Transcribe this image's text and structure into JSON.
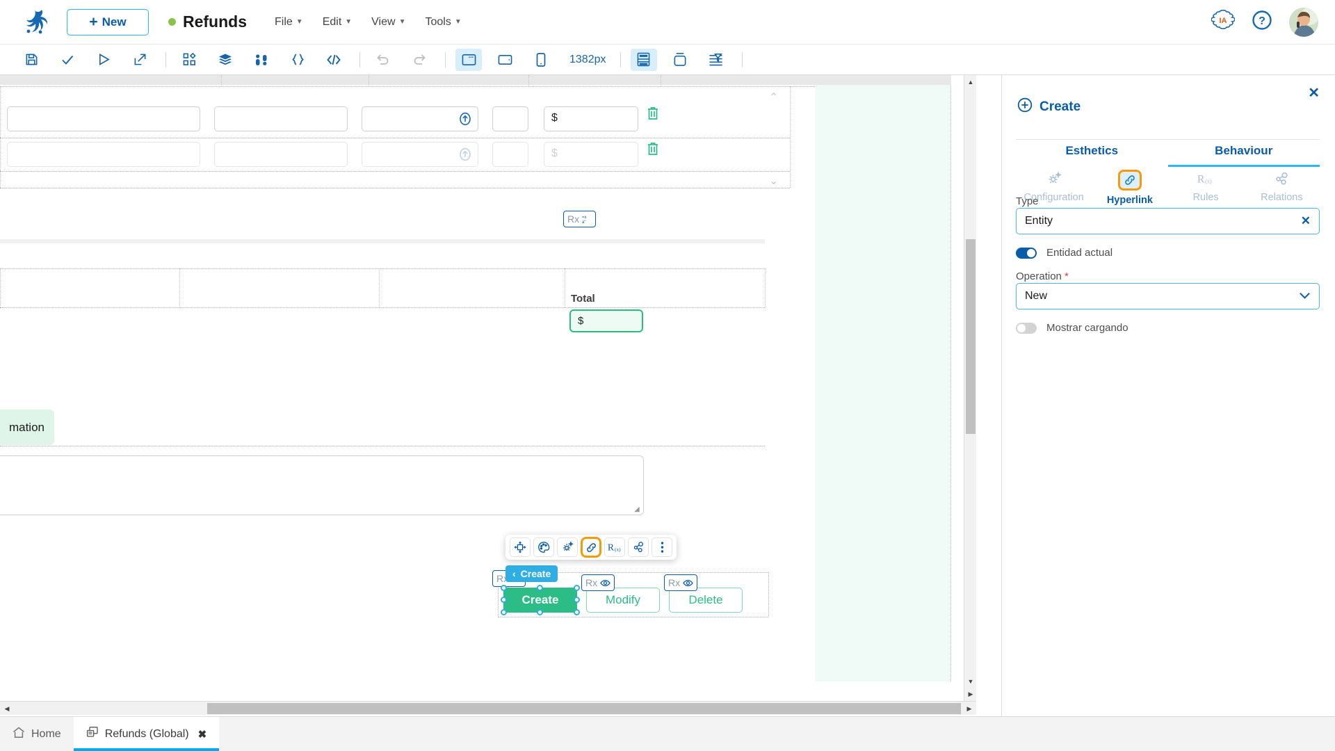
{
  "topbar": {
    "logo_icon": "frog-logo-icon",
    "new_button": {
      "label": "New",
      "plus": "+"
    },
    "document": {
      "title": "Refunds",
      "status_dot": "green"
    },
    "menus": [
      {
        "label": "File"
      },
      {
        "label": "Edit"
      },
      {
        "label": "View"
      },
      {
        "label": "Tools"
      }
    ],
    "right_icons": [
      {
        "name": "ia-icon",
        "label": "IA"
      },
      {
        "name": "help-icon",
        "label": "?"
      },
      {
        "name": "avatar",
        "label": ""
      }
    ]
  },
  "toolbar": {
    "zoom_value": "1382px",
    "buttons": [
      {
        "name": "save-icon",
        "state": "enabled"
      },
      {
        "name": "check-icon",
        "state": "enabled"
      },
      {
        "name": "run-icon",
        "state": "enabled"
      },
      {
        "name": "export-icon",
        "state": "enabled"
      },
      {
        "name": "components-icon",
        "state": "enabled"
      },
      {
        "name": "layers-icon",
        "state": "enabled"
      },
      {
        "name": "variables-icon",
        "state": "enabled"
      },
      {
        "name": "braces-icon",
        "state": "enabled"
      },
      {
        "name": "code-icon",
        "state": "enabled"
      },
      {
        "name": "undo-icon",
        "state": "disabled"
      },
      {
        "name": "redo-icon",
        "state": "disabled"
      },
      {
        "name": "desktop-view-icon",
        "state": "active"
      },
      {
        "name": "tablet-view-icon",
        "state": "enabled"
      },
      {
        "name": "mobile-view-icon",
        "state": "enabled"
      },
      {
        "name": "grid-layout-icon",
        "state": "active"
      },
      {
        "name": "container-icon",
        "state": "enabled"
      },
      {
        "name": "filter-icon",
        "state": "enabled"
      }
    ]
  },
  "canvas": {
    "grid": {
      "rows": [
        {
          "dollar": "$",
          "faded": false
        },
        {
          "dollar": "$",
          "faded": true
        }
      ],
      "delete_icon": "trash-icon",
      "stepper_icon": "upload-circle-icon",
      "scroll_up_icon": "chevron-up-icon",
      "scroll_down_icon": "chevron-down-icon"
    },
    "total": {
      "label": "Total",
      "value": "$",
      "badge": {
        "prefix": "Rx",
        "icon": "text-format-icon"
      }
    },
    "info_tag": {
      "label": "mation"
    },
    "element_toolbar": {
      "buttons": [
        {
          "name": "move-icon",
          "selected": false
        },
        {
          "name": "palette-icon",
          "selected": false
        },
        {
          "name": "settings-icon",
          "selected": false
        },
        {
          "name": "hyperlink-icon",
          "selected": true
        },
        {
          "name": "rules-icon",
          "selected": false
        },
        {
          "name": "relations-icon",
          "selected": false
        },
        {
          "name": "more-options-icon",
          "selected": false
        }
      ]
    },
    "selection_label": {
      "chevron": "‹",
      "label": "Create"
    },
    "action_buttons": [
      {
        "label": "Create",
        "style": "primary",
        "badge": {
          "prefix": "Rx",
          "icon": "eye-icon"
        }
      },
      {
        "label": "Modify",
        "style": "outline",
        "badge": {
          "prefix": "Rx",
          "icon": "eye-icon"
        }
      },
      {
        "label": "Delete",
        "style": "outline",
        "badge": {
          "prefix": "Rx",
          "icon": "eye-icon"
        }
      }
    ]
  },
  "right_panel": {
    "close_icon": "close-icon",
    "title": "Create",
    "title_icon": "plus-circle-icon",
    "tabs": [
      {
        "label": "Esthetics",
        "active": false
      },
      {
        "label": "Behaviour",
        "active": true
      }
    ],
    "subtabs": [
      {
        "label": "Configuration",
        "icon": "config-gear-icon",
        "active": false
      },
      {
        "label": "Hyperlink",
        "icon": "hyperlink-icon",
        "active": true
      },
      {
        "label": "Rules",
        "icon": "rules-icon",
        "active": false
      },
      {
        "label": "Relations",
        "icon": "relations-icon",
        "active": false
      }
    ],
    "fields": [
      {
        "name": "type",
        "label": "Type",
        "value": "Entity",
        "required": false,
        "trailing_icon": "clear-x-icon"
      },
      {
        "name": "operation",
        "label": "Operation",
        "value": "New",
        "required": true,
        "trailing_icon": "chevron-down-icon"
      }
    ],
    "toggles": [
      {
        "name": "entidad-actual",
        "label": "Entidad actual",
        "on": true
      },
      {
        "name": "mostrar-cargando",
        "label": "Mostrar cargando",
        "on": false
      }
    ]
  },
  "bottom_tabs": [
    {
      "label": "Home",
      "icon": "home-icon",
      "active": false,
      "closable": false
    },
    {
      "label": "Refunds (Global)",
      "icon": "page-icon",
      "active": true,
      "closable": true,
      "close": "✖"
    }
  ],
  "colors": {
    "brand_blue": "#0a5ca8",
    "accent_cyan": "#29b6f6",
    "highlight_orange": "#f59a09",
    "success_green": "#2bbd85",
    "mint_bg": "#f0faf6"
  }
}
